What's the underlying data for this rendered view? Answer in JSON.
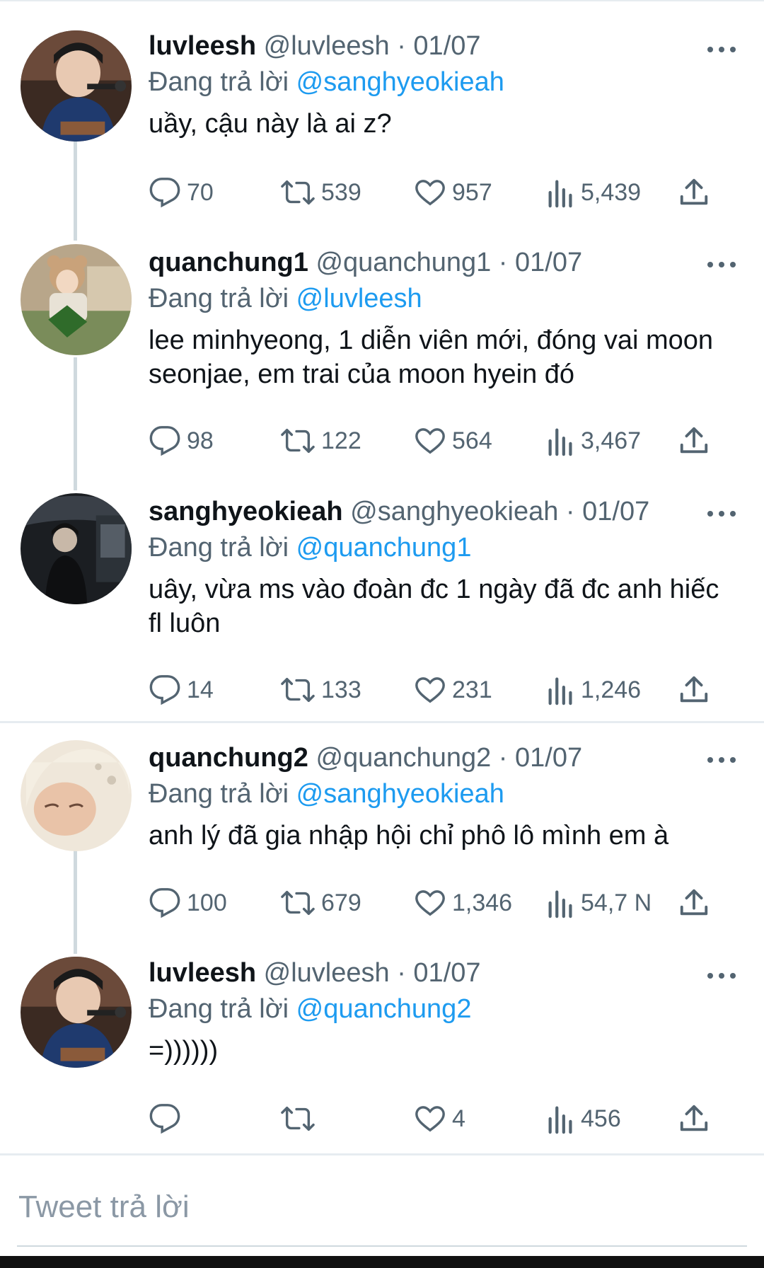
{
  "tweets": [
    {
      "name": "luvleesh",
      "handle": "@luvleesh",
      "date": "01/07",
      "reply_label": "Đang trả lời",
      "reply_to": "@sanghyeokieah",
      "text": "uầy, cậu này là ai z?",
      "replies": "70",
      "retweets": "539",
      "likes": "957",
      "views": "5,439"
    },
    {
      "name": "quanchung1",
      "handle": "@quanchung1",
      "date": "01/07",
      "reply_label": "Đang trả lời",
      "reply_to": "@luvleesh",
      "text": "lee minhyeong, 1 diễn viên mới, đóng vai moon seonjae, em trai của moon hyein đó",
      "replies": "98",
      "retweets": "122",
      "likes": "564",
      "views": "3,467"
    },
    {
      "name": "sanghyeokieah",
      "handle": "@sanghyeokieah",
      "date": "01/07",
      "reply_label": "Đang trả lời",
      "reply_to": "@quanchung1",
      "text": "uây, vừa ms vào đoàn đc 1 ngày đã đc anh hiếc fl luôn",
      "replies": "14",
      "retweets": "133",
      "likes": "231",
      "views": "1,246"
    },
    {
      "name": "quanchung2",
      "handle": "@quanchung2",
      "date": "01/07",
      "reply_label": "Đang trả lời",
      "reply_to": "@sanghyeokieah",
      "text": "anh lý đã gia nhập hội chỉ phô lô mình em à",
      "replies": "100",
      "retweets": "679",
      "likes": "1,346",
      "views": "54,7 N"
    },
    {
      "name": "luvleesh",
      "handle": "@luvleesh",
      "date": "01/07",
      "reply_label": "Đang trả lời",
      "reply_to": "@quanchung2",
      "text": "=))))))",
      "replies": "",
      "retweets": "",
      "likes": "4",
      "views": "456"
    }
  ],
  "composer": {
    "placeholder": "Tweet trả lời"
  },
  "icons": {
    "reply": "reply-icon",
    "retweet": "retweet-icon",
    "like": "heart-icon",
    "views": "views-icon",
    "share": "share-icon",
    "more": "more-icon"
  },
  "colors": {
    "mention": "#1d9bf0",
    "secondary": "#536471",
    "primary": "#0f1419"
  }
}
